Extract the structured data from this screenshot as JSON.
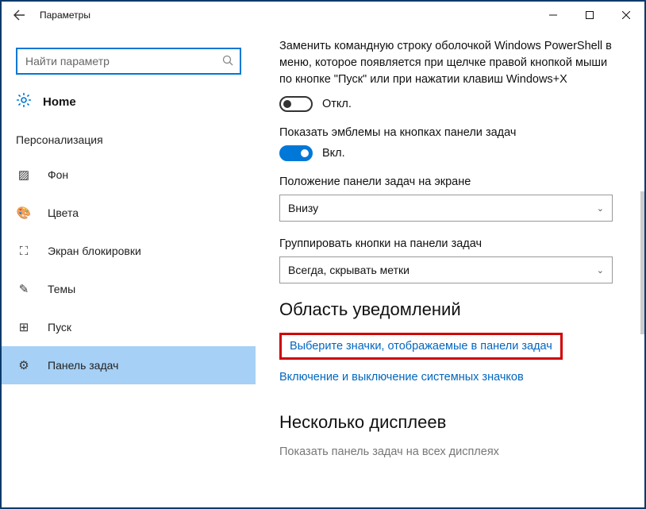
{
  "window": {
    "title": "Параметры"
  },
  "search": {
    "placeholder": "Найти параметр"
  },
  "home": {
    "label": "Home"
  },
  "section": "Персонализация",
  "nav": {
    "items": [
      {
        "icon": "image-icon",
        "glyph": "▨",
        "label": "Фон"
      },
      {
        "icon": "palette-icon",
        "glyph": "🎨",
        "label": "Цвета"
      },
      {
        "icon": "lock-icon",
        "glyph": "⛶",
        "label": "Экран блокировки"
      },
      {
        "icon": "brush-icon",
        "glyph": "✎",
        "label": "Темы"
      },
      {
        "icon": "start-icon",
        "glyph": "⊞",
        "label": "Пуск"
      },
      {
        "icon": "taskbar-icon",
        "glyph": "⚙",
        "label": "Панель задач"
      }
    ],
    "selected_index": 5
  },
  "main": {
    "cmd_replacement_text": "Заменить командную строку оболочкой Windows PowerShell в меню, которое появляется при щелчке правой кнопкой мыши по кнопке \"Пуск\" или при нажатии клавиш Windows+X",
    "toggle_off": "Откл.",
    "show_badges_label": "Показать эмблемы на кнопках панели задач",
    "toggle_on": "Вкл.",
    "taskbar_position_label": "Положение панели задач на экране",
    "taskbar_position_value": "Внизу",
    "group_buttons_label": "Группировать кнопки на панели задач",
    "group_buttons_value": "Всегда, скрывать метки",
    "notification_area_heading": "Область уведомлений",
    "link_select_icons": "Выберите значки, отображаемые в панели задач",
    "link_system_icons": "Включение и выключение системных значков",
    "multiple_displays_heading": "Несколько дисплеев",
    "show_on_all_displays": "Показать панель задач на всех дисплеях"
  }
}
